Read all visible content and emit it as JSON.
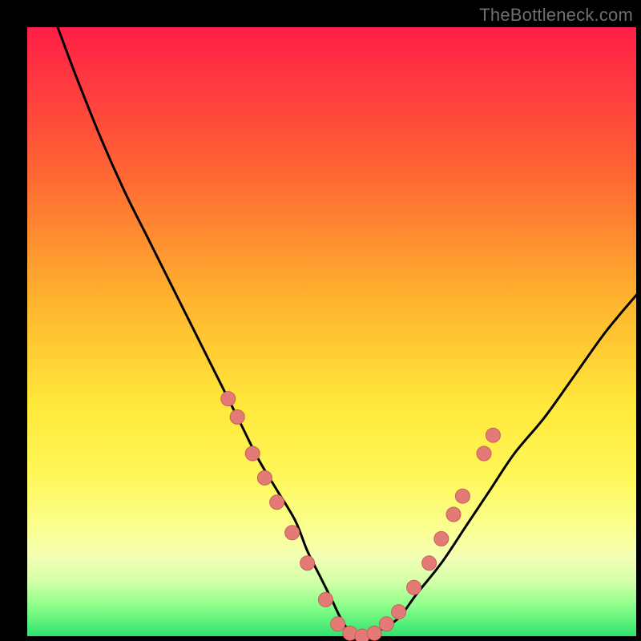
{
  "watermark": "TheBottleneck.com",
  "colors": {
    "frame": "#000000",
    "gradient_top": "#ff1f47",
    "gradient_bottom": "#2fe36e",
    "curve": "#000000",
    "dot_fill": "#e47a76",
    "dot_stroke": "#c95f5b"
  },
  "chart_data": {
    "type": "line",
    "title": "",
    "xlabel": "",
    "ylabel": "",
    "xlim": [
      0,
      100
    ],
    "ylim": [
      0,
      100
    ],
    "series": [
      {
        "name": "bottleneck-curve",
        "x": [
          5,
          8,
          12,
          16,
          20,
          24,
          28,
          32,
          35,
          38,
          41,
          44,
          46,
          48,
          50,
          52,
          54,
          56,
          58,
          61,
          64,
          68,
          72,
          76,
          80,
          85,
          90,
          95,
          100
        ],
        "y": [
          100,
          92,
          82,
          73,
          65,
          57,
          49,
          41,
          35,
          29,
          24,
          19,
          14,
          10,
          6,
          2,
          0,
          0,
          1,
          3,
          7,
          12,
          18,
          24,
          30,
          36,
          43,
          50,
          56
        ]
      }
    ],
    "markers": [
      {
        "x": 33,
        "y": 39
      },
      {
        "x": 34.5,
        "y": 36
      },
      {
        "x": 37,
        "y": 30
      },
      {
        "x": 39,
        "y": 26
      },
      {
        "x": 41,
        "y": 22
      },
      {
        "x": 43.5,
        "y": 17
      },
      {
        "x": 46,
        "y": 12
      },
      {
        "x": 49,
        "y": 6
      },
      {
        "x": 51,
        "y": 2
      },
      {
        "x": 53,
        "y": 0.5
      },
      {
        "x": 55,
        "y": 0
      },
      {
        "x": 57,
        "y": 0.5
      },
      {
        "x": 59,
        "y": 2
      },
      {
        "x": 61,
        "y": 4
      },
      {
        "x": 63.5,
        "y": 8
      },
      {
        "x": 66,
        "y": 12
      },
      {
        "x": 68,
        "y": 16
      },
      {
        "x": 70,
        "y": 20
      },
      {
        "x": 71.5,
        "y": 23
      },
      {
        "x": 75,
        "y": 30
      },
      {
        "x": 76.5,
        "y": 33
      }
    ]
  }
}
